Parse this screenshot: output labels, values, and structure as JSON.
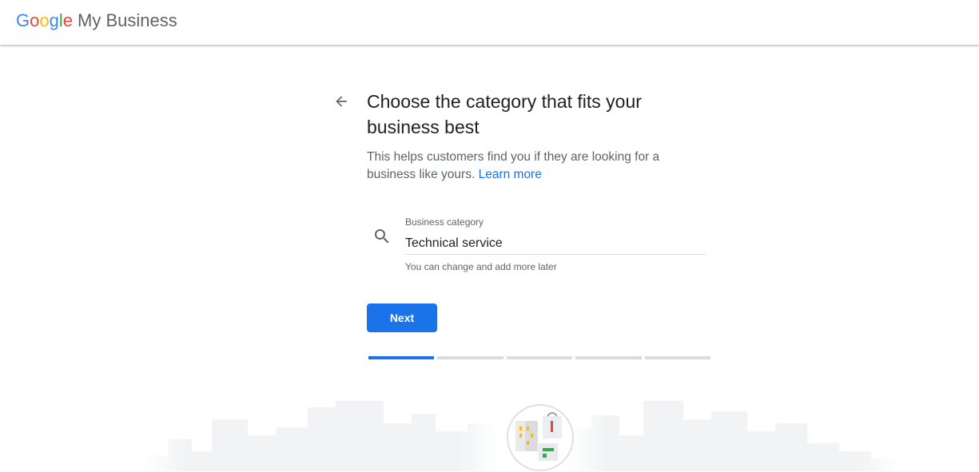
{
  "header": {
    "logo_letters": [
      "G",
      "o",
      "o",
      "g",
      "l",
      "e"
    ],
    "product_name": "My Business"
  },
  "page": {
    "title": "Choose the category that fits your business best",
    "description": "This helps customers find you if they are looking for a business like yours.",
    "learn_more": "Learn more"
  },
  "category_field": {
    "label": "Business category",
    "value": "Technical service",
    "helper": "You can change and add more later"
  },
  "actions": {
    "next_label": "Next"
  },
  "progress": {
    "current_step": 1,
    "total_steps": 5
  },
  "colors": {
    "accent": "#1a73e8",
    "google_blue": "#4285f4",
    "google_red": "#ea4335",
    "google_yellow": "#fbbc05",
    "google_green": "#34a853"
  }
}
